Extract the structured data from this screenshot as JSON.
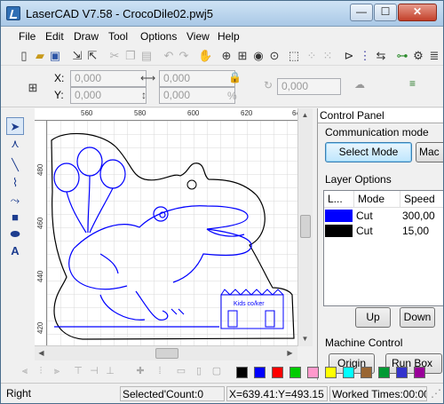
{
  "window": {
    "title": "LaserCAD V7.58 - CrocoDile02.pwj5",
    "min_glyph": "—",
    "max_glyph": "☐",
    "close_glyph": "✕"
  },
  "menu": [
    "File",
    "Edit",
    "Draw",
    "Tool",
    "Options",
    "View",
    "Help"
  ],
  "toolbar_icons": [
    "new-file-icon",
    "open-folder-icon",
    "save-icon",
    "import-icon",
    "export-icon",
    "cut-icon",
    "copy-icon",
    "paste-icon",
    "delete-icon",
    "undo-icon",
    "redo-icon",
    "pan-hand-icon",
    "zoom-window-icon",
    "zoom-fit-icon",
    "zoom-page-icon",
    "zoom-in-icon",
    "select-all-icon",
    "node-edit-icon",
    "group-icon",
    "ungroup-icon",
    "laser-path-icon",
    "array-icon",
    "align-icon",
    "mirror-icon",
    "settings-icon",
    "layers-icon"
  ],
  "coords": {
    "x_label": "X:",
    "y_label": "Y:",
    "x_value": "0,000",
    "y_value": "0,000",
    "w_value": "0,000",
    "h_value": "0,000",
    "percent_symbol": "%",
    "angle_value": "0,000"
  },
  "left_tools": [
    "select-arrow-icon",
    "node-edit-icon",
    "line-icon",
    "polyline-icon",
    "bezier-icon",
    "rectangle-icon",
    "ellipse-icon",
    "text-icon"
  ],
  "ruler": {
    "h_ticks": [
      "560",
      "580",
      "600",
      "620",
      "640"
    ],
    "v_ticks": [
      "480",
      "460",
      "440",
      "420",
      "400"
    ]
  },
  "panel": {
    "title": "Control Panel",
    "comm_label": "Communication mode",
    "select_mode_label": "Select Mode",
    "mac_label": "Mac",
    "layer_options_label": "Layer Options",
    "columns": [
      "L...",
      "Mode",
      "Speed"
    ],
    "layers": [
      {
        "color": "#0000ff",
        "mode": "Cut",
        "speed": "300,00"
      },
      {
        "color": "#000000",
        "mode": "Cut",
        "speed": "15,00"
      }
    ],
    "up_label": "Up",
    "down_label": "Down",
    "machine_control_label": "Machine Control",
    "origin_label": "Origin",
    "run_box_label": "Run Box"
  },
  "palette": [
    "#000000",
    "#0000ff",
    "#ff0000",
    "#00cc00",
    "#ff99cc",
    "#ffff00",
    "#00ffff",
    "#996633",
    "#009933",
    "#3333cc",
    "#990099"
  ],
  "status": {
    "mode": "Right",
    "selected": "Selected'Count:0",
    "xy": "X=639.41:Y=493.15",
    "worked": "Worked Times:00:00"
  },
  "drawing": {
    "sign_text": "Kids co/ker"
  }
}
